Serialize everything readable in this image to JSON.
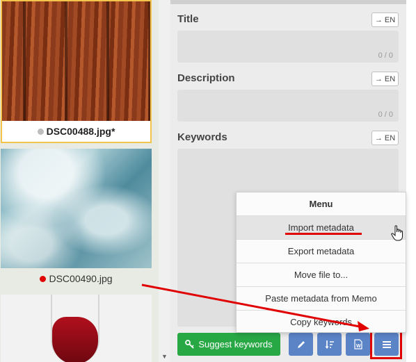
{
  "thumbnails": [
    {
      "filename": "DSC00488.jpg*",
      "status_color": "#bdbdbd",
      "selected": true
    },
    {
      "filename": "DSC00490.jpg",
      "status_color": "#e00000",
      "selected": false
    }
  ],
  "fields": {
    "title": {
      "label": "Title",
      "lang": "→ EN",
      "counter": "0 / 0"
    },
    "description": {
      "label": "Description",
      "lang": "→ EN",
      "counter": "0 / 0"
    },
    "keywords": {
      "label": "Keywords",
      "lang": "→ EN"
    }
  },
  "menu": {
    "header": "Menu",
    "items": [
      "Import metadata",
      "Export metadata",
      "Move file to...",
      "Paste metadata from Memo",
      "Copy keywords"
    ]
  },
  "toolbar": {
    "suggest_label": "Suggest keywords"
  },
  "colors": {
    "annotation": "#e00000",
    "suggest": "#28a745",
    "tool_button": "#5b84c7",
    "selection_border": "#f3c44b"
  },
  "icons": {
    "suggest": "key-icon",
    "edit": "pencil-icon",
    "sort": "sort-icon",
    "word": "word-doc-icon",
    "menu": "hamburger-menu-icon",
    "scroll": "scroll-down-arrow-icon"
  }
}
